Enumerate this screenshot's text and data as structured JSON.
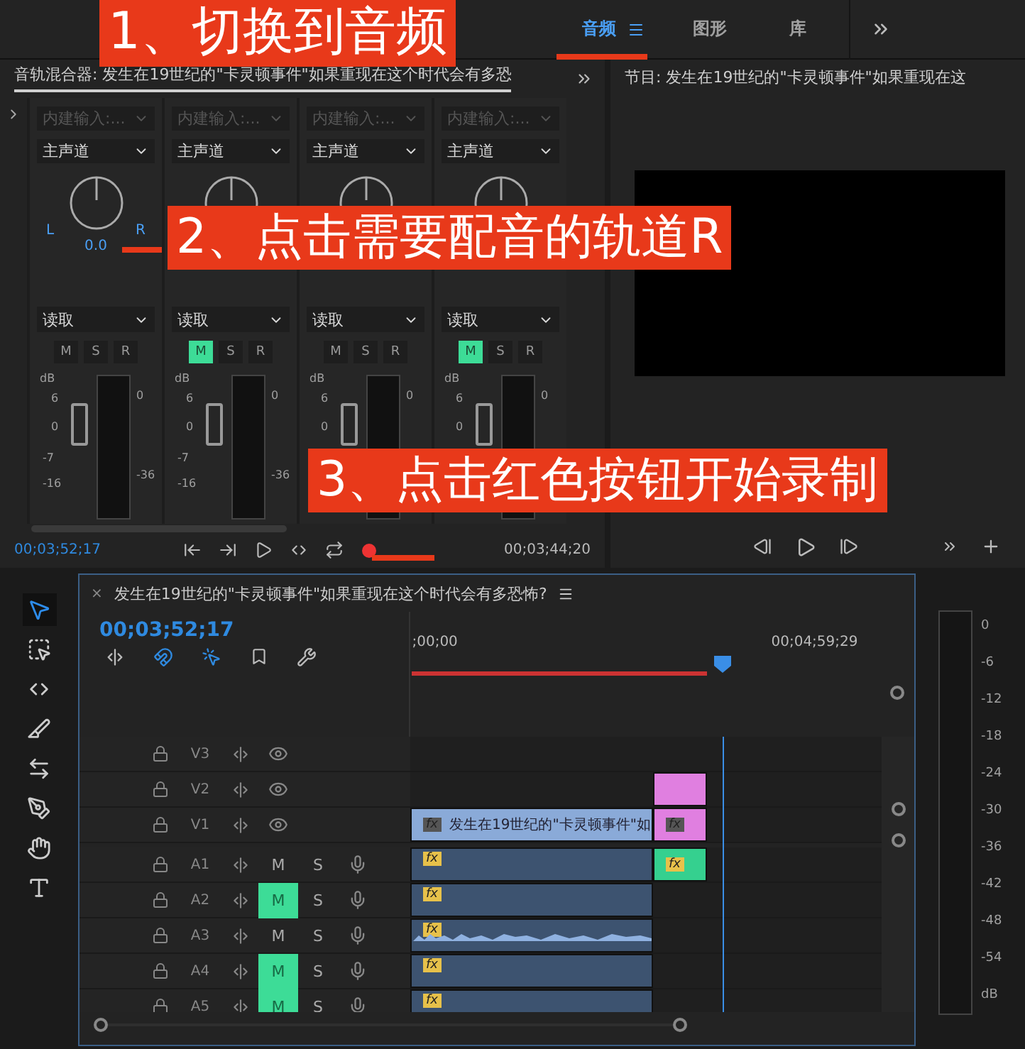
{
  "workspace_tabs": [
    {
      "label": "音频",
      "selected": true
    },
    {
      "label": "图形",
      "selected": false
    },
    {
      "label": "库",
      "selected": false
    }
  ],
  "annotations": [
    {
      "text": "1、切换到音频"
    },
    {
      "text": "2、点击需要配音的轨道R"
    },
    {
      "text": "3、点击红色按钮开始录制"
    }
  ],
  "mixer": {
    "title": "音轨混合器: 发生在19世纪的\"卡灵顿事件\"如果重现在这个时代会有多恐",
    "channels": [
      {
        "input": "内建输入:...",
        "input_disabled": true,
        "output": "主声道",
        "pan": {
          "left": "L",
          "right": "R",
          "value": "0.0"
        },
        "automation": "读取",
        "buttons": [
          {
            "label": "M",
            "on": false
          },
          {
            "label": "S",
            "on": false
          },
          {
            "label": "R",
            "on": false
          }
        ],
        "fader_scale": [
          "dB",
          "6",
          "0",
          "-7",
          "-16"
        ],
        "meter_scale": [
          "0",
          "-36"
        ]
      },
      {
        "input": "内建输入:...",
        "input_disabled": true,
        "output": "主声道",
        "automation": "读取",
        "buttons": [
          {
            "label": "M",
            "on": true
          },
          {
            "label": "S",
            "on": false
          },
          {
            "label": "R",
            "on": false
          }
        ],
        "fader_scale": [
          "dB",
          "6",
          "0",
          "-7",
          "-16"
        ],
        "meter_scale": [
          "0",
          "-36"
        ]
      },
      {
        "input": "内建输入:...",
        "input_disabled": true,
        "output": "主声道",
        "automation": "读取",
        "buttons": [
          {
            "label": "M",
            "on": false
          },
          {
            "label": "S",
            "on": false
          },
          {
            "label": "R",
            "on": false
          }
        ],
        "fader_scale": [
          "dB",
          "6",
          "0"
        ],
        "meter_scale": [
          "0"
        ]
      },
      {
        "input": "内建输入:...",
        "input_disabled": true,
        "output": "主声道",
        "automation": "读取",
        "buttons": [
          {
            "label": "M",
            "on": true
          },
          {
            "label": "S",
            "on": false
          },
          {
            "label": "R",
            "on": false
          }
        ],
        "fader_scale": [
          "dB",
          "6",
          "0"
        ],
        "meter_scale": [
          "0"
        ]
      }
    ],
    "current_time": "00;03;52;17",
    "end_time": "00;03;44;20"
  },
  "program": {
    "title": "节目: 发生在19世纪的\"卡灵顿事件\"如果重现在这"
  },
  "tools": [
    {
      "kind": "selection",
      "selected": true
    },
    {
      "kind": "track_select",
      "selected": false
    },
    {
      "kind": "ripple",
      "selected": false
    },
    {
      "kind": "razor",
      "selected": false
    },
    {
      "kind": "slip",
      "selected": false
    },
    {
      "kind": "pen",
      "selected": false
    },
    {
      "kind": "hand",
      "selected": false
    },
    {
      "kind": "type",
      "selected": false
    }
  ],
  "timeline": {
    "close": "×",
    "title": "发生在19世纪的\"卡灵顿事件\"如果重现在这个时代会有多恐怖?",
    "timecode": "00;03;52;17",
    "ruler_start": ";00;00",
    "ruler_end": "00;04;59;29",
    "tracks": [
      {
        "kind": "video",
        "name": "V3"
      },
      {
        "kind": "video",
        "name": "V2",
        "clips": [
          {
            "kind": "graphic"
          }
        ]
      },
      {
        "kind": "video",
        "name": "V1",
        "clips": [
          {
            "kind": "video",
            "effect": "fx",
            "label": "发生在19世纪的\"卡灵顿事件\"如"
          },
          {
            "kind": "graphic",
            "effect": "fx"
          }
        ]
      },
      {
        "kind": "audio",
        "name": "A1",
        "mute_label": "M",
        "solo_label": "S",
        "muted": false,
        "clips": [
          {
            "kind": "audio",
            "effect": "fx",
            "waveform": false
          },
          {
            "kind": "linked",
            "effect": "fx"
          }
        ]
      },
      {
        "kind": "audio",
        "name": "A2",
        "mute_label": "M",
        "solo_label": "S",
        "muted": true,
        "clips": [
          {
            "kind": "audio",
            "effect": "fx",
            "waveform": false
          }
        ]
      },
      {
        "kind": "audio",
        "name": "A3",
        "mute_label": "M",
        "solo_label": "S",
        "muted": false,
        "clips": [
          {
            "kind": "audio",
            "effect": "fx",
            "waveform": true
          }
        ]
      },
      {
        "kind": "audio",
        "name": "A4",
        "mute_label": "M",
        "solo_label": "S",
        "muted": true,
        "clips": [
          {
            "kind": "audio",
            "effect": "fx",
            "waveform": false
          }
        ]
      },
      {
        "kind": "audio",
        "name": "A5",
        "mute_label": "M",
        "solo_label": "S",
        "muted": true,
        "clips": [
          {
            "kind": "audio",
            "effect": "fx",
            "waveform": false
          }
        ]
      }
    ]
  },
  "meter": {
    "scale": [
      "0",
      "-6",
      "-12",
      "-18",
      "-24",
      "-30",
      "-36",
      "-42",
      "-48",
      "-54",
      "dB"
    ]
  }
}
